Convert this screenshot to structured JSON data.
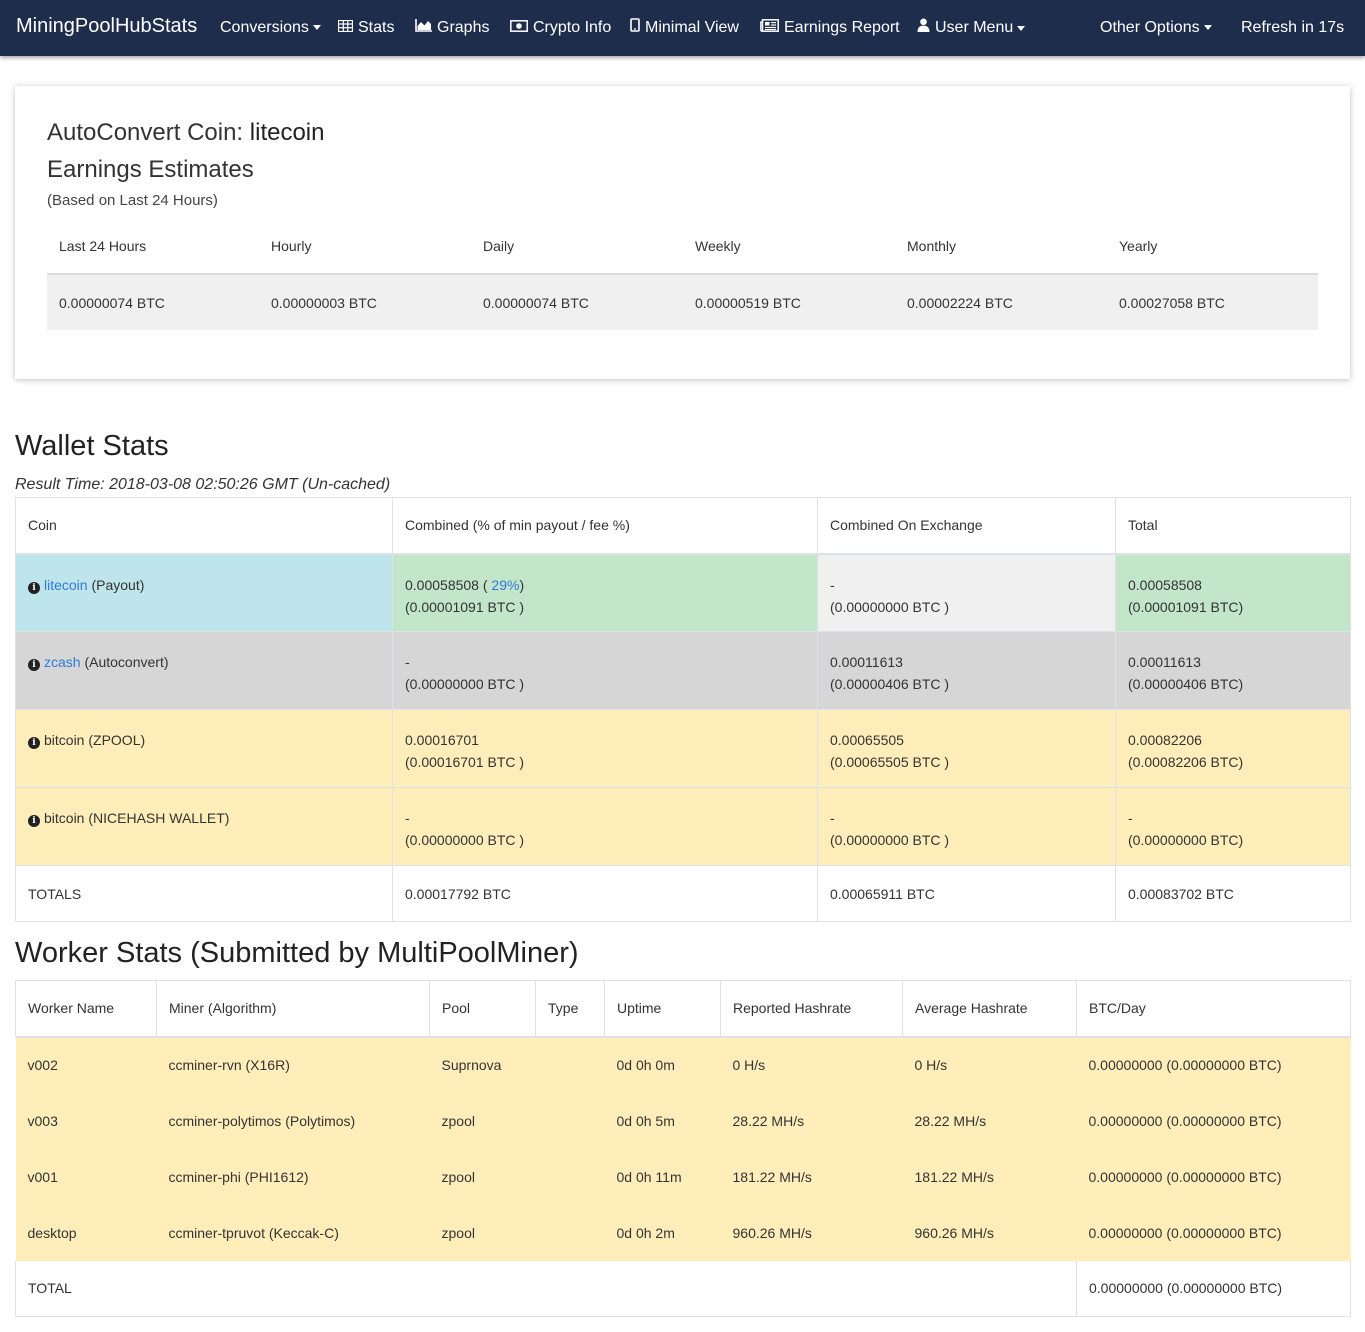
{
  "navbar": {
    "brand": "MiningPoolHubStats",
    "items": [
      {
        "label": "Conversions",
        "icon": "",
        "dropdown": true
      },
      {
        "label": "Stats",
        "icon": "table-icon"
      },
      {
        "label": "Graphs",
        "icon": "area-chart-icon"
      },
      {
        "label": "Crypto Info",
        "icon": "money-icon"
      },
      {
        "label": "Minimal View",
        "icon": "mobile-icon"
      },
      {
        "label": "Earnings Report",
        "icon": "newspaper-icon"
      },
      {
        "label": "User Menu",
        "icon": "user-icon",
        "dropdown": true
      }
    ],
    "other_options": "Other Options",
    "refresh": "Refresh in 17s"
  },
  "estimates": {
    "autoconvert_prefix": "AutoConvert Coin: ",
    "autoconvert_coin": "litecoin",
    "title": "Earnings Estimates",
    "subtitle": "(Based on Last 24 Hours)",
    "headers": [
      "Last 24 Hours",
      "Hourly",
      "Daily",
      "Weekly",
      "Monthly",
      "Yearly"
    ],
    "values": [
      "0.00000074 BTC",
      "0.00000003 BTC",
      "0.00000074 BTC",
      "0.00000519 BTC",
      "0.00002224 BTC",
      "0.00027058 BTC"
    ]
  },
  "wallet": {
    "title": "Wallet Stats",
    "result_time": "Result Time: 2018-03-08 02:50:26 GMT (Un-cached)",
    "headers": [
      "Coin",
      "Combined (% of min payout / fee %)",
      "Combined On Exchange",
      "Total"
    ],
    "rows": [
      {
        "coin": "litecoin",
        "coin_tag": " (Payout)",
        "combined_line1": "0.00058508 (",
        "combined_pct": " 29%",
        "combined_close": ")",
        "combined_line2": "(0.00001091 BTC )",
        "exchange_line1": "-",
        "exchange_line2": "(0.00000000 BTC )",
        "total_line1": "0.00058508",
        "total_line2": "(0.00001091 BTC)"
      },
      {
        "coin": "zcash",
        "coin_tag": " (Autoconvert)",
        "combined_line1": "-",
        "combined_line2": "(0.00000000 BTC )",
        "exchange_line1": "0.00011613",
        "exchange_line2": "(0.00000406 BTC )",
        "total_line1": "0.00011613",
        "total_line2": "(0.00000406 BTC)"
      },
      {
        "coin": "bitcoin",
        "coin_tag": " (ZPOOL)",
        "combined_line1": "0.00016701",
        "combined_line2": "(0.00016701 BTC )",
        "exchange_line1": "0.00065505",
        "exchange_line2": "(0.00065505 BTC )",
        "total_line1": "0.00082206",
        "total_line2": "(0.00082206 BTC)"
      },
      {
        "coin": "bitcoin",
        "coin_tag": " (NICEHASH WALLET)",
        "combined_line1": "-",
        "combined_line2": "(0.00000000 BTC )",
        "exchange_line1": "-",
        "exchange_line2": "(0.00000000 BTC )",
        "total_line1": "-",
        "total_line2": "(0.00000000 BTC)"
      }
    ],
    "totals": {
      "label": "TOTALS",
      "combined": "0.00017792 BTC",
      "exchange": "0.00065911 BTC",
      "total": "0.00083702 BTC"
    }
  },
  "workers": {
    "title": "Worker Stats (Submitted by MultiPoolMiner)",
    "headers": [
      "Worker Name",
      "Miner (Algorithm)",
      "Pool",
      "Type",
      "Uptime",
      "Reported Hashrate",
      "Average Hashrate",
      "BTC/Day"
    ],
    "rows": [
      {
        "name": "v002",
        "miner": "ccminer-rvn (X16R)",
        "pool": "Suprnova",
        "type": "",
        "uptime": "0d 0h 0m",
        "reported": "0 H/s",
        "average": "0 H/s",
        "btc_day": "0.00000000 (0.00000000 BTC)"
      },
      {
        "name": "v003",
        "miner": "ccminer-polytimos (Polytimos)",
        "pool": "zpool",
        "type": "",
        "uptime": "0d 0h 5m",
        "reported": "28.22 MH/s",
        "average": "28.22 MH/s",
        "btc_day": "0.00000000 (0.00000000 BTC)"
      },
      {
        "name": "v001",
        "miner": "ccminer-phi (PHI1612)",
        "pool": "zpool",
        "type": "",
        "uptime": "0d 0h 11m",
        "reported": "181.22 MH/s",
        "average": "181.22 MH/s",
        "btc_day": "0.00000000 (0.00000000 BTC)"
      },
      {
        "name": "desktop",
        "miner": "ccminer-tpruvot (Keccak-C)",
        "pool": "zpool",
        "type": "",
        "uptime": "0d 0h 2m",
        "reported": "960.26 MH/s",
        "average": "960.26 MH/s",
        "btc_day": "0.00000000 (0.00000000 BTC)"
      }
    ],
    "total": {
      "label": "TOTAL",
      "btc_day": "0.00000000 (0.00000000 BTC)"
    }
  },
  "colors": {
    "navbar_bg": "#1f2d4d",
    "link": "#2f7bd8",
    "row_info": "#bee5eb",
    "row_success": "#c3e6cb",
    "row_light": "#f0f0f0",
    "row_grey": "#d6d6d6",
    "row_warning": "#ffeeba"
  }
}
